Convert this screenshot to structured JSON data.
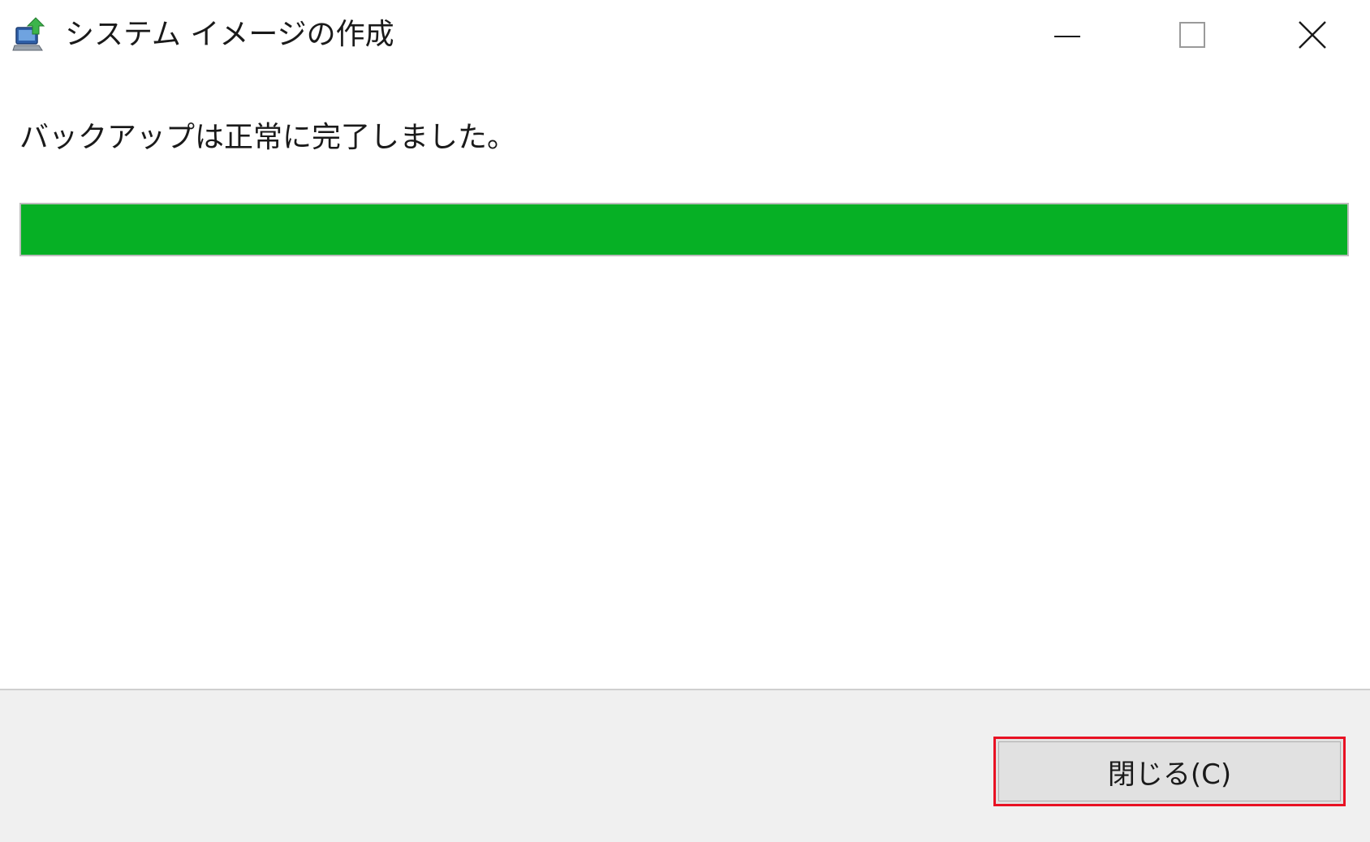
{
  "window": {
    "title": "システム イメージの作成",
    "icon": "backup-computer-icon"
  },
  "caption_buttons": {
    "minimize_icon": "minimize-icon",
    "maximize_icon": "maximize-icon",
    "close_icon": "close-icon"
  },
  "content": {
    "status_text": "バックアップは正常に完了しました。",
    "progress_percent": 100
  },
  "footer": {
    "close_button_label": "閉じる(C)"
  },
  "colors": {
    "progress_fill": "#06b025",
    "highlight_border": "#e81123",
    "footer_background": "#f0f0f0"
  }
}
